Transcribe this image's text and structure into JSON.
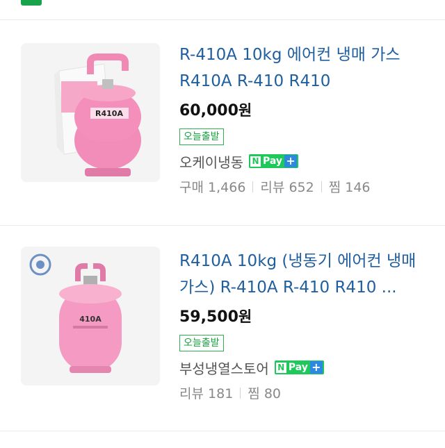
{
  "header": {
    "title": "",
    "more_label": ""
  },
  "products": [
    {
      "name": "R-410A 10kg 에어컨 냉매 가스 R410A R-410 R410",
      "price": "60,000",
      "price_unit": "원",
      "badge": "오늘출발",
      "seller": "오케이냉동",
      "npay_label": "Pay",
      "stats": [
        {
          "label": "구매",
          "value": "1,466"
        },
        {
          "label": "리뷰",
          "value": "652"
        },
        {
          "label": "찜",
          "value": "146"
        }
      ],
      "can_label": "R410A"
    },
    {
      "name": "R410A 10kg (냉동기 에어컨 냉매가스) R-410A R-410 R410 ...",
      "price": "59,500",
      "price_unit": "원",
      "badge": "오늘출발",
      "seller": "부성냉열스토어",
      "npay_label": "Pay",
      "stats": [
        {
          "label": "리뷰",
          "value": "181"
        },
        {
          "label": "찜",
          "value": "80"
        }
      ],
      "can_label": "410A"
    }
  ],
  "colors": {
    "link": "#1f5fa0",
    "badge_green": "#15a33e",
    "npay_green": "#1fc85a",
    "plus_blue": "#2d88e2",
    "can_pink": "#f28cb8"
  }
}
